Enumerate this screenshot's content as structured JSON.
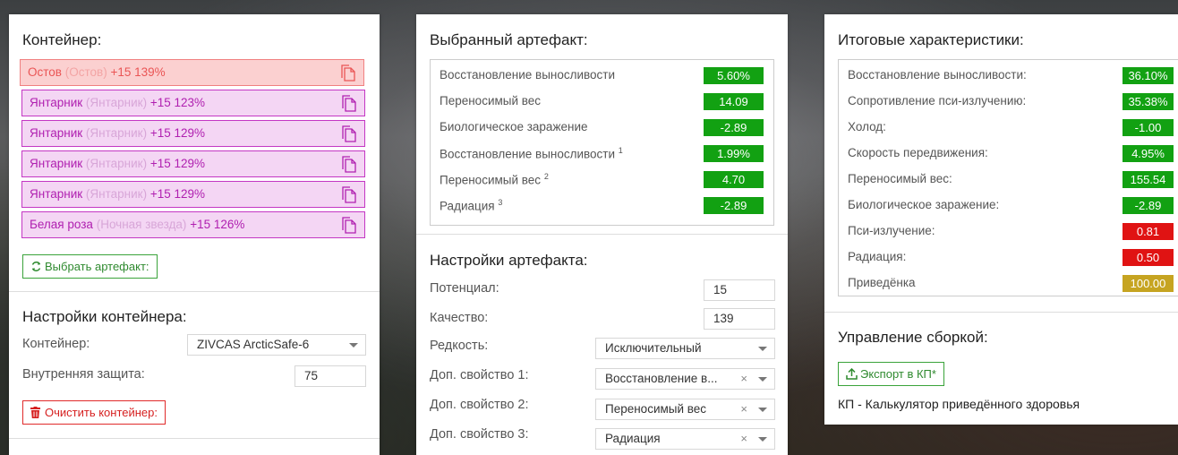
{
  "container_panel": {
    "title": "Контейнер:",
    "items": [
      {
        "name": "Остов",
        "orig": "(Остов)",
        "detail": "+15 139%"
      },
      {
        "name": "Янтарник",
        "orig": "(Янтарник)",
        "detail": "+15 123%"
      },
      {
        "name": "Янтарник",
        "orig": "(Янтарник)",
        "detail": "+15 129%"
      },
      {
        "name": "Янтарник",
        "orig": "(Янтарник)",
        "detail": "+15 129%"
      },
      {
        "name": "Янтарник",
        "orig": "(Янтарник)",
        "detail": "+15 129%"
      },
      {
        "name": "Белая роза",
        "orig": "(Ночная звезда)",
        "detail": "+15 126%"
      }
    ],
    "choose_button": "Выбрать артефакт:",
    "settings_title": "Настройки контейнера:",
    "container_label": "Контейнер:",
    "container_value": "ZIVCAS ArcticSafe-6",
    "protection_label": "Внутренняя защита:",
    "protection_value": "75",
    "clear_button": "Очистить контейнер:"
  },
  "artifact_panel": {
    "title": "Выбранный артефакт:",
    "stats": [
      {
        "label": "Восстановление выносливости",
        "sup": "",
        "value": "5.60%"
      },
      {
        "label": "Переносимый вес",
        "sup": "",
        "value": "14.09"
      },
      {
        "label": "Биологическое заражение",
        "sup": "",
        "value": "-2.89"
      },
      {
        "label": "Восстановление выносливости",
        "sup": "1",
        "value": "1.99%"
      },
      {
        "label": "Переносимый вес",
        "sup": "2",
        "value": "4.70"
      },
      {
        "label": "Радиация",
        "sup": "3",
        "value": "-2.89"
      }
    ],
    "settings_title": "Настройки артефакта:",
    "potential_label": "Потенциал:",
    "potential_value": "15",
    "quality_label": "Качество:",
    "quality_value": "139",
    "rarity_label": "Редкость:",
    "rarity_value": "Исключительный",
    "extra1_label": "Доп. свойство 1:",
    "extra1_value": "Восстановление в...",
    "extra2_label": "Доп. свойство 2:",
    "extra2_value": "Переносимый вес",
    "extra3_label": "Доп. свойство 3:",
    "extra3_value": "Радиация",
    "clear_symbol": "×"
  },
  "totals_panel": {
    "title": "Итоговые характеристики:",
    "stats": [
      {
        "label": "Восстановление выносливости:",
        "value": "36.10%",
        "status": "positive"
      },
      {
        "label": "Сопротивление пси-излучению:",
        "value": "35.38%",
        "status": "positive"
      },
      {
        "label": "Холод:",
        "value": "-1.00",
        "status": "positive"
      },
      {
        "label": "Скорость передвижения:",
        "value": "4.95%",
        "status": "positive"
      },
      {
        "label": "Переносимый вес:",
        "value": "155.54",
        "status": "positive"
      },
      {
        "label": "Биологическое заражение:",
        "value": "-2.89",
        "status": "positive"
      },
      {
        "label": "Пси-излучение:",
        "value": "0.81",
        "status": "negative"
      },
      {
        "label": "Радиация:",
        "value": "0.50",
        "status": "negative"
      },
      {
        "label": "Приведёнка",
        "value": "100.00",
        "status": "neutral"
      }
    ],
    "manage_title": "Управление сборкой:",
    "export_button": "Экспорт в КП*",
    "footnote": "КП - Калькулятор приведённого здоровья"
  },
  "colors": {
    "positive": "#12a112",
    "negative": "#e01313",
    "neutral": "#c6a421",
    "item_border": "#c437c4",
    "item_bg": "#f4d6f4",
    "selected_border": "#f08080",
    "selected_bg": "#fbd0d0"
  },
  "icons": {
    "copy": "copy-icon",
    "refresh": "refresh-icon",
    "trash": "trash-icon",
    "export": "upload-icon",
    "dropdown": "chevron-down-icon"
  }
}
